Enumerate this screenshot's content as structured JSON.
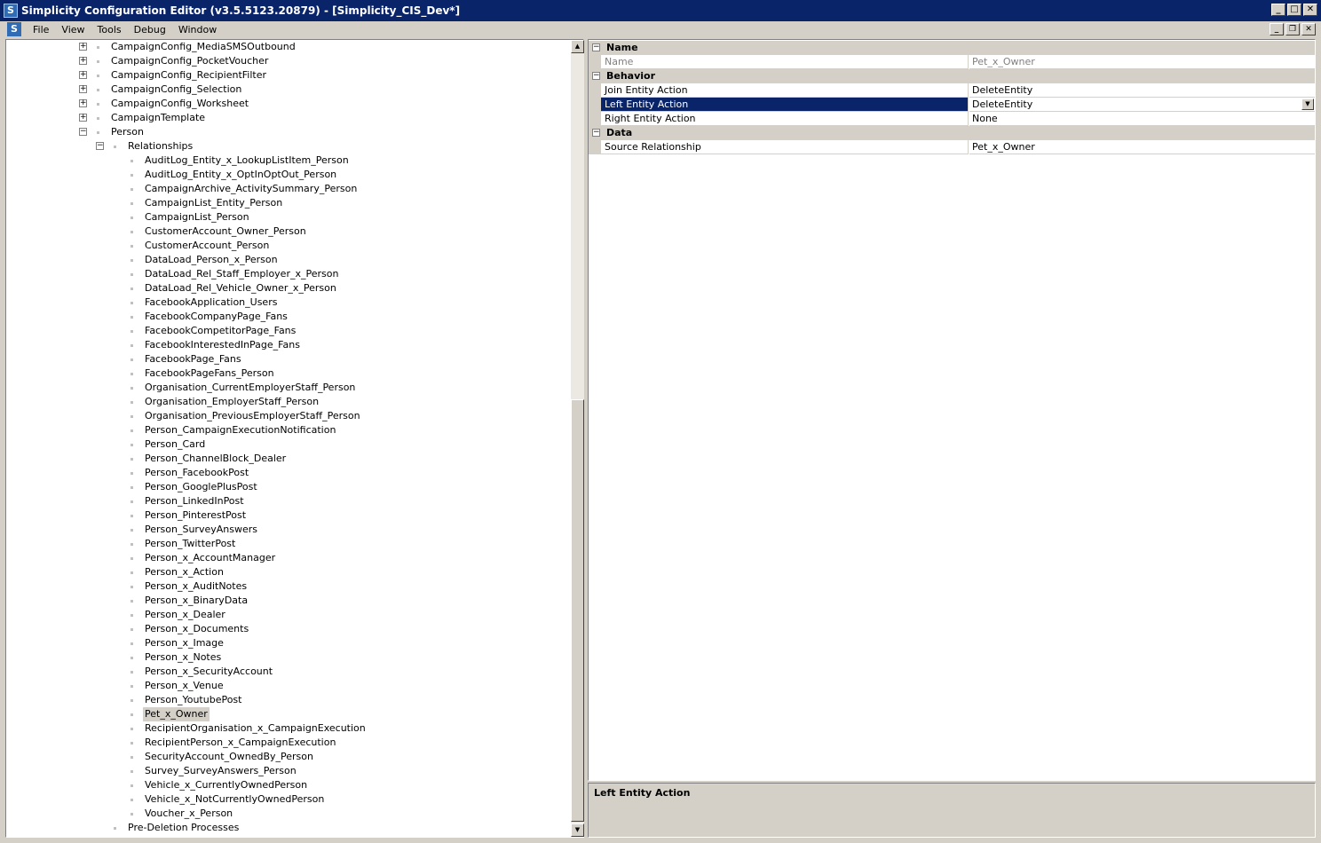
{
  "window": {
    "title": "Simplicity Configuration Editor (v3.5.5123.20879) - [Simplicity_CIS_Dev*]",
    "app_icon": "S",
    "buttons": {
      "minimize": "_",
      "maximize": "□",
      "close": "✕"
    }
  },
  "menubar": {
    "icon": "S",
    "items": [
      "File",
      "View",
      "Tools",
      "Debug",
      "Window"
    ],
    "mdi_buttons": {
      "minimize": "_",
      "restore": "❐",
      "close": "✕"
    }
  },
  "tree": {
    "items": [
      {
        "label": "CampaignConfig_MediaSMSOutbound",
        "level": 1,
        "expander": "+"
      },
      {
        "label": "CampaignConfig_PocketVoucher",
        "level": 1,
        "expander": "+"
      },
      {
        "label": "CampaignConfig_RecipientFilter",
        "level": 1,
        "expander": "+"
      },
      {
        "label": "CampaignConfig_Selection",
        "level": 1,
        "expander": "+"
      },
      {
        "label": "CampaignConfig_Worksheet",
        "level": 1,
        "expander": "+"
      },
      {
        "label": "CampaignTemplate",
        "level": 1,
        "expander": "+"
      },
      {
        "label": "Person",
        "level": 1,
        "expander": "−"
      },
      {
        "label": "Relationships",
        "level": 2,
        "expander": "−"
      },
      {
        "label": "AuditLog_Entity_x_LookupListItem_Person",
        "level": 3
      },
      {
        "label": "AuditLog_Entity_x_OptInOptOut_Person",
        "level": 3
      },
      {
        "label": "CampaignArchive_ActivitySummary_Person",
        "level": 3
      },
      {
        "label": "CampaignList_Entity_Person",
        "level": 3
      },
      {
        "label": "CampaignList_Person",
        "level": 3
      },
      {
        "label": "CustomerAccount_Owner_Person",
        "level": 3
      },
      {
        "label": "CustomerAccount_Person",
        "level": 3
      },
      {
        "label": "DataLoad_Person_x_Person",
        "level": 3
      },
      {
        "label": "DataLoad_Rel_Staff_Employer_x_Person",
        "level": 3
      },
      {
        "label": "DataLoad_Rel_Vehicle_Owner_x_Person",
        "level": 3
      },
      {
        "label": "FacebookApplication_Users",
        "level": 3
      },
      {
        "label": "FacebookCompanyPage_Fans",
        "level": 3
      },
      {
        "label": "FacebookCompetitorPage_Fans",
        "level": 3
      },
      {
        "label": "FacebookInterestedInPage_Fans",
        "level": 3
      },
      {
        "label": "FacebookPage_Fans",
        "level": 3
      },
      {
        "label": "FacebookPageFans_Person",
        "level": 3
      },
      {
        "label": "Organisation_CurrentEmployerStaff_Person",
        "level": 3
      },
      {
        "label": "Organisation_EmployerStaff_Person",
        "level": 3
      },
      {
        "label": "Organisation_PreviousEmployerStaff_Person",
        "level": 3
      },
      {
        "label": "Person_CampaignExecutionNotification",
        "level": 3
      },
      {
        "label": "Person_Card",
        "level": 3
      },
      {
        "label": "Person_ChannelBlock_Dealer",
        "level": 3
      },
      {
        "label": "Person_FacebookPost",
        "level": 3
      },
      {
        "label": "Person_GooglePlusPost",
        "level": 3
      },
      {
        "label": "Person_LinkedInPost",
        "level": 3
      },
      {
        "label": "Person_PinterestPost",
        "level": 3
      },
      {
        "label": "Person_SurveyAnswers",
        "level": 3
      },
      {
        "label": "Person_TwitterPost",
        "level": 3
      },
      {
        "label": "Person_x_AccountManager",
        "level": 3
      },
      {
        "label": "Person_x_Action",
        "level": 3
      },
      {
        "label": "Person_x_AuditNotes",
        "level": 3
      },
      {
        "label": "Person_x_BinaryData",
        "level": 3
      },
      {
        "label": "Person_x_Dealer",
        "level": 3
      },
      {
        "label": "Person_x_Documents",
        "level": 3
      },
      {
        "label": "Person_x_Image",
        "level": 3
      },
      {
        "label": "Person_x_Notes",
        "level": 3
      },
      {
        "label": "Person_x_SecurityAccount",
        "level": 3
      },
      {
        "label": "Person_x_Venue",
        "level": 3
      },
      {
        "label": "Person_YoutubePost",
        "level": 3
      },
      {
        "label": "Pet_x_Owner",
        "level": 3,
        "selected": true
      },
      {
        "label": "RecipientOrganisation_x_CampaignExecution",
        "level": 3
      },
      {
        "label": "RecipientPerson_x_CampaignExecution",
        "level": 3
      },
      {
        "label": "SecurityAccount_OwnedBy_Person",
        "level": 3
      },
      {
        "label": "Survey_SurveyAnswers_Person",
        "level": 3
      },
      {
        "label": "Vehicle_x_CurrentlyOwnedPerson",
        "level": 3
      },
      {
        "label": "Vehicle_x_NotCurrentlyOwnedPerson",
        "level": 3
      },
      {
        "label": "Voucher_x_Person",
        "level": 3
      },
      {
        "label": "Pre-Deletion Processes",
        "level": 2
      }
    ],
    "scroll_up": "▲",
    "scroll_down": "▼"
  },
  "properties": {
    "rows": [
      {
        "kind": "category",
        "label": "Name",
        "expander": "−"
      },
      {
        "kind": "prop",
        "name": "Name",
        "value": "Pet_x_Owner",
        "readonly": true
      },
      {
        "kind": "category",
        "label": "Behavior",
        "expander": "−"
      },
      {
        "kind": "prop",
        "name": "Join Entity Action",
        "value": "DeleteEntity"
      },
      {
        "kind": "prop",
        "name": "Left Entity Action",
        "value": "DeleteEntity",
        "selected": true,
        "dropdown": "▼"
      },
      {
        "kind": "prop",
        "name": "Right Entity Action",
        "value": "None"
      },
      {
        "kind": "category",
        "label": "Data",
        "expander": "−"
      },
      {
        "kind": "prop",
        "name": "Source Relationship",
        "value": "Pet_x_Owner"
      }
    ]
  },
  "description": {
    "title": "Left Entity Action"
  }
}
